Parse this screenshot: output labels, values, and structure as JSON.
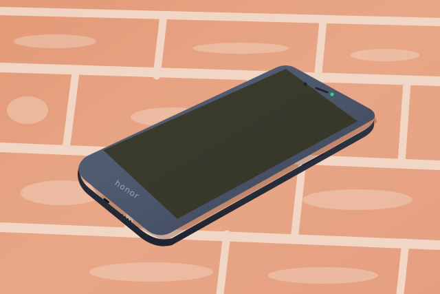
{
  "photo": {
    "subject": "smartphone",
    "surface": "brick-wall",
    "colors": {
      "brick": "#e8a787",
      "mortar": "#f3dccd",
      "phone_body": "#4c566a",
      "screen": "#3a3a2c",
      "camera_led": "#35d07a"
    }
  },
  "phone": {
    "brand_label": "honor"
  }
}
